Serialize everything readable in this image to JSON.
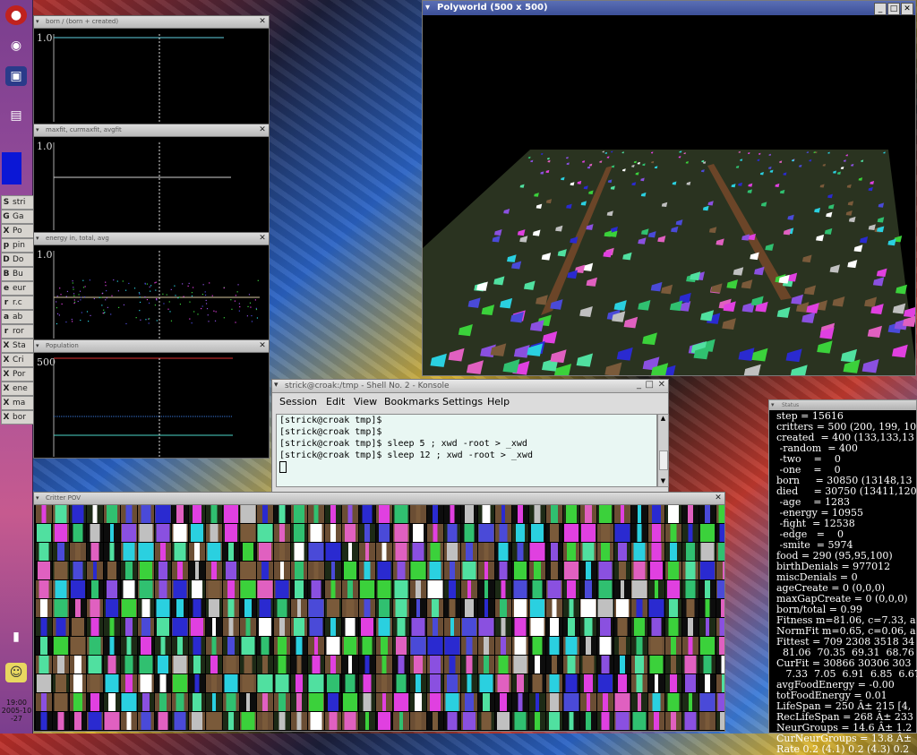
{
  "taskbar": {
    "tasks": [
      {
        "icon": "S",
        "label": "stri"
      },
      {
        "icon": "G",
        "label": "Ga"
      },
      {
        "icon": "X",
        "label": "Po"
      },
      {
        "icon": "p",
        "label": "pin"
      },
      {
        "icon": "D",
        "label": "Do"
      },
      {
        "icon": "B",
        "label": "Bu"
      },
      {
        "icon": "e",
        "label": "eur"
      },
      {
        "icon": "r",
        "label": "r.c"
      },
      {
        "icon": "a",
        "label": "ab"
      },
      {
        "icon": "r",
        "label": "ror"
      },
      {
        "icon": "X",
        "label": "Sta"
      },
      {
        "icon": "X",
        "label": "Cri"
      },
      {
        "icon": "X",
        "label": "Por"
      },
      {
        "icon": "X",
        "label": "ene"
      },
      {
        "icon": "X",
        "label": "ma"
      },
      {
        "icon": "X",
        "label": "bor"
      }
    ],
    "clock_time": "19:00",
    "clock_date": "2005-10",
    "clock_day": "-27"
  },
  "graph_born": {
    "title": "born / (born + created)",
    "ylabel": "1.0"
  },
  "graph_fit": {
    "title": "maxfit, curmaxfit, avgfit",
    "ylabel": "1.0"
  },
  "graph_energy": {
    "title": "energy in, total, avg",
    "ylabel": "1.0"
  },
  "graph_pop": {
    "title": "Population",
    "ylabel": "500"
  },
  "polyworld": {
    "title": "Polyworld (500 x 500)"
  },
  "konsole": {
    "title": "strick@croak:/tmp - Shell No. 2 - Konsole",
    "menu": [
      "Session",
      "Edit",
      "View",
      "Bookmarks",
      "Settings",
      "Help"
    ],
    "lines": [
      "[strick@croak tmp]$",
      "[strick@croak tmp]$",
      "[strick@croak tmp]$ sleep 5 ; xwd -root > _xwd",
      "[strick@croak tmp]$ sleep 12 ; xwd -root > _xwd"
    ]
  },
  "pov": {
    "title": "Critter POV"
  },
  "status": {
    "title": "Status",
    "lines": [
      "step = 15616",
      "critters = 500 (200, 199, 10",
      "created  = 400 (133,133,13",
      " -random  = 400",
      " -two    =    0",
      " -one    =    0",
      "born     = 30850 (13148,13",
      "died     = 30750 (13411,120",
      " -age    = 1283",
      " -energy = 10955",
      " -fight  = 12538",
      " -edge   =    0",
      " -smite  = 5974",
      "food = 290 (95,95,100)",
      "birthDenials = 977012",
      "miscDenials = 0",
      "ageCreate = 0 (0,0,0)",
      "maxGapCreate = 0 (0,0,0)",
      "born/total = 0.99",
      "Fitness m=81.06, c=7.33, a",
      "NormFit m=0.65, c=0.06, a",
      "Fittest = 709 2308 3518 34",
      "  81.06  70.35  69.31  68.76",
      "CurFit = 30866 30306 303",
      "   7.33  7.05  6.91  6.85  6.67",
      "avgFoodEnergy = -0.00",
      "totFoodEnergy = 0.01",
      "LifeSpan = 250 Â± 215 [4,",
      "RecLifeSpan = 268 Â± 233",
      "NeurGroups = 14.6 Â± 1.2",
      "CurNeurGroups = 13.8 Â±",
      "Rate 0.2 (4.1) 0.2 (4.3) 0.2"
    ]
  }
}
